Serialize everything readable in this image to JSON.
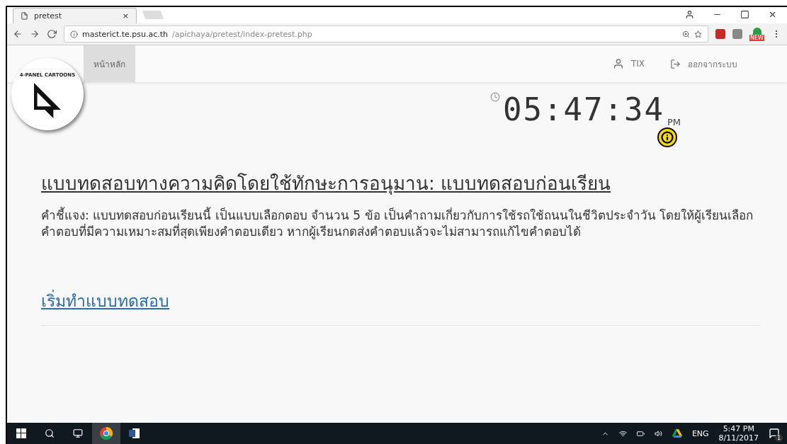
{
  "browser": {
    "tabs": [
      {
        "title": "pretest",
        "close": "×",
        "selected": true
      }
    ],
    "url_host": "masterict.te.psu.ac.th",
    "url_path": "/apichaya/pretest/index-pretest.php",
    "extension_badge": "NEW"
  },
  "navbar": {
    "logo_text": "4-PANEL CARTOONS",
    "items": [
      {
        "label": "หน้าหลัก",
        "selected": true
      }
    ],
    "user": "TIX",
    "logout": "ออกจากระบบ"
  },
  "clock": {
    "time": "05:47:34",
    "meridiem": "PM"
  },
  "title": "แบบทดสอบทางความคิดโดยใช้ทักษะการอนุมาน: แบบทดสอบก่อนเรียน",
  "instructions": "คำชี้แจง: แบบทดสอบก่อนเรียนนี้ เป็นแบบเลือกตอบ จำนวน 5 ข้อ เป็นคำถามเกี่ยวกับการใช้รถใช้ถนนในชีวิตประจำวัน โดยให้ผู้เรียนเลือกคำตอบที่มีความเหมาะสมที่สุดเพียงคำตอบเดียว หากผู้เรียนกดส่งคำตอบแล้วจะไม่สามารถแก้ไขคำตอบได้",
  "start_link": "เริ่มทำแบบทดสอบ",
  "taskbar": {
    "apps": [
      {
        "kind": "chrome",
        "selected": true
      },
      {
        "kind": "word",
        "selected": false
      }
    ],
    "language": "ENG",
    "time": "5:47 PM",
    "date": "8/11/2017",
    "notifications": "1"
  }
}
